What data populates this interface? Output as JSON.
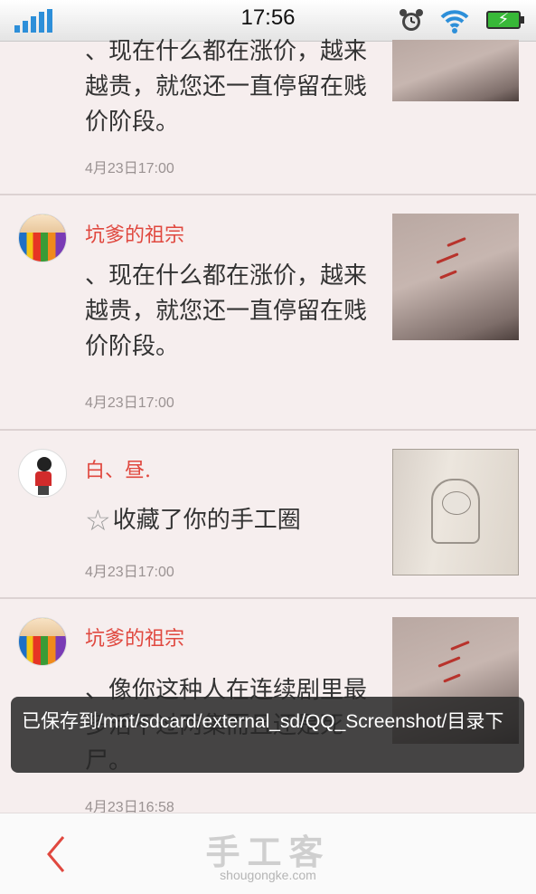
{
  "status_bar": {
    "time": "17:56",
    "icons": [
      "signal-icon",
      "alarm-icon",
      "wifi-icon",
      "battery-charging-icon"
    ]
  },
  "feed": {
    "items": [
      {
        "content": "、现在什么都在涨价，越来越贵，就您还一直停留在贱价阶段。",
        "timestamp": "4月23日17:00",
        "thumbnail": "arm-photo"
      },
      {
        "username": "坑爹的祖宗",
        "content": "、现在什么都在涨价，越来越贵，就您还一直停留在贱价阶段。",
        "timestamp": "4月23日17:00",
        "avatar": "pencils-avatar",
        "thumbnail": "arm-photo"
      },
      {
        "username": "白、昼.",
        "content": "收藏了你的手工圈",
        "timestamp": "4月23日17:00",
        "avatar": "girl-avatar",
        "thumbnail": "book-sketch-photo"
      },
      {
        "username": "坑爹的祖宗",
        "content": "、像你这种人在连续剧里最多活不过两集而且还是死尸。",
        "timestamp": "4月23日16:58",
        "avatar": "pencils-avatar",
        "thumbnail": "arm-photo"
      }
    ]
  },
  "toast": {
    "message": "已保存到/mnt/sdcard/external_sd/QQ_Screenshot/目录下"
  },
  "bottom_bar": {
    "logo_text": "手工客",
    "logo_url_text": "shougongke.com"
  },
  "colors": {
    "username": "#e0483f",
    "background": "#f6eeee",
    "toast_bg": "#282828"
  }
}
